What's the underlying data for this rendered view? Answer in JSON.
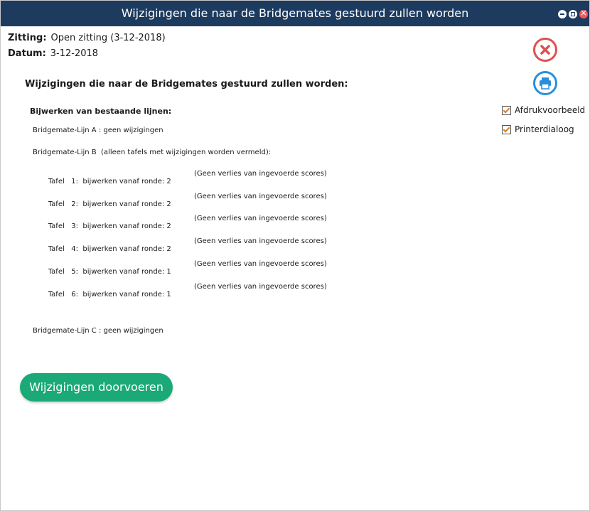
{
  "window": {
    "title": "Wijzigingen die naar de Bridgemates gestuurd zullen worden"
  },
  "info": {
    "zitting_label": "Zitting:",
    "zitting_value": "Open zitting (3-12-2018)",
    "datum_label": "Datum:",
    "datum_value": "3-12-2018"
  },
  "content": {
    "heading": "Wijzigingen die naar de Bridgemates gestuurd zullen worden:",
    "subheading": "Bijwerken van bestaande lijnen:",
    "line_a": "Bridgemate-Lijn A : geen wijzigingen",
    "line_b": "Bridgemate-Lijn B  (alleen tafels met wijzigingen worden vermeld):",
    "tables": [
      {
        "text": "Tafel   1:  bijwerken vanaf ronde: 2",
        "note": "(Geen verlies van ingevoerde scores)"
      },
      {
        "text": "Tafel   2:  bijwerken vanaf ronde: 2",
        "note": "(Geen verlies van ingevoerde scores)"
      },
      {
        "text": "Tafel   3:  bijwerken vanaf ronde: 2",
        "note": "(Geen verlies van ingevoerde scores)"
      },
      {
        "text": "Tafel   4:  bijwerken vanaf ronde: 2",
        "note": "(Geen verlies van ingevoerde scores)"
      },
      {
        "text": "Tafel   5:  bijwerken vanaf ronde: 1",
        "note": "(Geen verlies van ingevoerde scores)"
      },
      {
        "text": "Tafel   6:  bijwerken vanaf ronde: 1",
        "note": "(Geen verlies van ingevoerde scores)"
      }
    ],
    "line_c": "Bridgemate-Lijn C : geen wijzigingen"
  },
  "actions": {
    "apply_label": "Wijzigingen doorvoeren"
  },
  "options": {
    "preview_label": "Afdrukvoorbeeld",
    "preview_checked": true,
    "dialog_label": "Printerdialoog",
    "dialog_checked": true
  },
  "icons": {
    "cancel": "close-circle-icon",
    "print": "printer-icon",
    "accent": "#1ba977",
    "title_bg": "#1d3b5e"
  }
}
